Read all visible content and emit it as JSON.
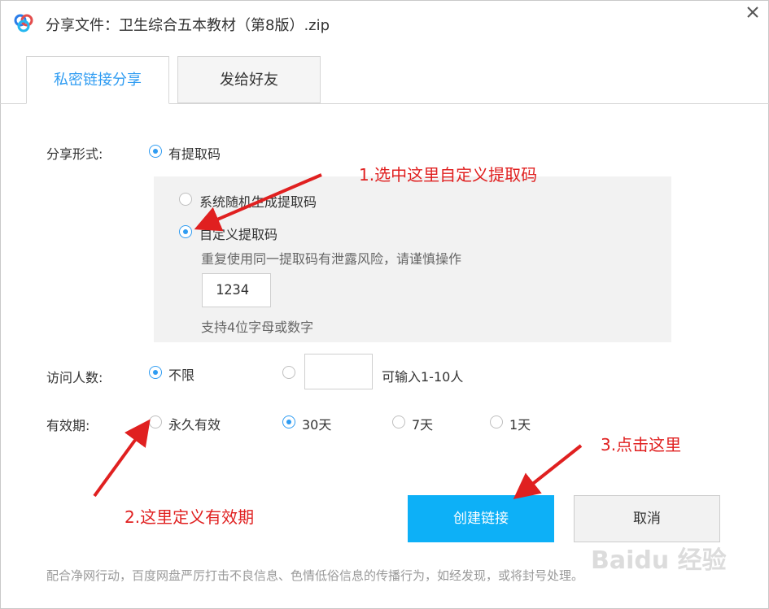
{
  "window": {
    "title": "分享文件：卫生综合五本教材（第8版）.zip"
  },
  "tabs": [
    {
      "label": "私密链接分享",
      "active": true
    },
    {
      "label": "发给好友",
      "active": false
    }
  ],
  "share_form": {
    "label": "分享形式:",
    "option_with_code": "有提取码",
    "random_code_option": "系统随机生成提取码",
    "custom_code_option": "自定义提取码",
    "warning": "重复使用同一提取码有泄露风险，请谨慎操作",
    "code_value": "1234",
    "code_hint": "支持4位字母或数字"
  },
  "visitors": {
    "label": "访问人数:",
    "unlimited": "不限",
    "custom_value": "",
    "custom_hint": "可输入1-10人"
  },
  "validity": {
    "label": "有效期:",
    "options": [
      "永久有效",
      "30天",
      "7天",
      "1天"
    ],
    "selected": "30天"
  },
  "buttons": {
    "create": "创建链接",
    "cancel": "取消"
  },
  "footer_notice": "配合净网行动，百度网盘严厉打击不良信息、色情低俗信息的传播行为，如经发现，或将封号处理。",
  "annotations": {
    "step1": "1.选中这里自定义提取码",
    "step2": "2.这里定义有效期",
    "step3": "3.点击这里"
  },
  "watermark": "Baidu 经验",
  "colors": {
    "accent": "#2f9cf2",
    "primary_button": "#0db0f7",
    "annotation": "#e02020"
  }
}
